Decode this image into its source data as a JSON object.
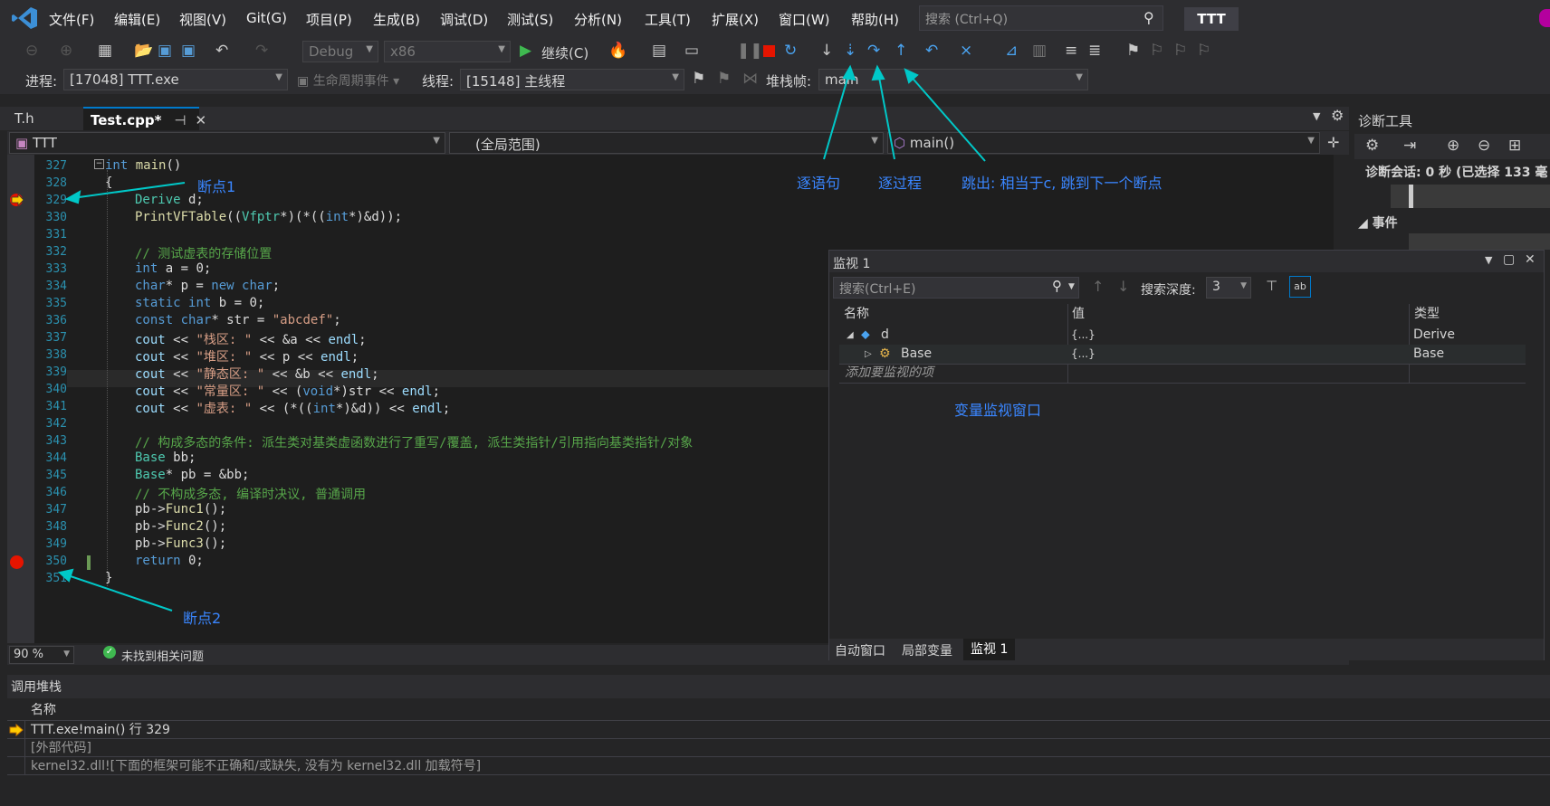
{
  "menubar": {
    "items": [
      "文件(F)",
      "编辑(E)",
      "视图(V)",
      "Git(G)",
      "项目(P)",
      "生成(B)",
      "调试(D)",
      "测试(S)",
      "分析(N)",
      "工具(T)",
      "扩展(X)",
      "窗口(W)",
      "帮助(H)"
    ],
    "search_placeholder": "搜索 (Ctrl+Q)",
    "solution_badge": "TTT"
  },
  "toolbar": {
    "config": "Debug",
    "platform": "x86",
    "continue_label": "继续(C)"
  },
  "debugbar": {
    "process_label": "进程:",
    "process_value": "[17048] TTT.exe",
    "lifecycle_label": "生命周期事件",
    "thread_label": "线程:",
    "thread_value": "[15148] 主线程",
    "stackframe_label": "堆栈帧:",
    "stackframe_value": "main"
  },
  "tabs": [
    {
      "label": "T.h"
    },
    {
      "label": "Test.cpp*"
    }
  ],
  "navbar": {
    "project": "TTT",
    "scope": "(全局范围)",
    "member": "main()"
  },
  "editor": {
    "lines": [
      {
        "n": "327",
        "code": "int main()"
      },
      {
        "n": "328",
        "code": "{"
      },
      {
        "n": "329",
        "code": "Derive d;"
      },
      {
        "n": "330",
        "code": "PrintVFTable((Vfptr*)(*((int*)&d));"
      },
      {
        "n": "331",
        "code": ""
      },
      {
        "n": "332",
        "code": "// 测试虚表的存储位置"
      },
      {
        "n": "333",
        "code": "int a = 0;"
      },
      {
        "n": "334",
        "code": "char* p = new char;"
      },
      {
        "n": "335",
        "code": "static int b = 0;"
      },
      {
        "n": "336",
        "code": "const char* str = \"abcdef\";"
      },
      {
        "n": "337",
        "code": "cout << \"栈区: \" << &a << endl;"
      },
      {
        "n": "338",
        "code": "cout << \"堆区: \" << p << endl;"
      },
      {
        "n": "339",
        "code": "cout << \"静态区: \" << &b << endl;"
      },
      {
        "n": "340",
        "code": "cout << \"常量区: \" << (void*)str << endl;"
      },
      {
        "n": "341",
        "code": "cout << \"虚表: \" << (*((int*)&d)) << endl;"
      },
      {
        "n": "342",
        "code": ""
      },
      {
        "n": "343",
        "code": "// 构成多态的条件: 派生类对基类虚函数进行了重写/覆盖, 派生类指针/引用指向基类指针/对象"
      },
      {
        "n": "344",
        "code": "Base bb;"
      },
      {
        "n": "345",
        "code": "Base* pb = &bb;"
      },
      {
        "n": "346",
        "code": "// 不构成多态, 编译时决议, 普通调用"
      },
      {
        "n": "347",
        "code": "pb->Func1();"
      },
      {
        "n": "348",
        "code": "pb->Func2();"
      },
      {
        "n": "349",
        "code": "pb->Func3();"
      },
      {
        "n": "350",
        "code": "return 0;"
      },
      {
        "n": "351",
        "code": "}"
      }
    ]
  },
  "annotations": {
    "bp1": "断点1",
    "bp2": "断点2",
    "step_into": "逐语句",
    "step_over": "逐过程",
    "step_out": "跳出: 相当于c, 跳到下一个断点",
    "watch_note": "变量监视窗口"
  },
  "status": {
    "zoom": "90 %",
    "issues": "未找到相关问题"
  },
  "diag": {
    "title": "诊断工具",
    "session": "诊断会话: 0 秒 (已选择 133 毫",
    "events": "事件"
  },
  "watch": {
    "title": "监视 1",
    "search_placeholder": "搜索(Ctrl+E)",
    "depth_label": "搜索深度:",
    "depth_value": "3",
    "col_name": "名称",
    "col_value": "值",
    "col_type": "类型",
    "rows": [
      {
        "name": "d",
        "value": "{...}",
        "type": "Derive"
      },
      {
        "name": "Base",
        "value": "{...}",
        "type": "Base"
      }
    ],
    "add_item": "添加要监视的项",
    "tabs": [
      "自动窗口",
      "局部变量",
      "监视 1"
    ]
  },
  "callstack": {
    "title": "调用堆栈",
    "col_name": "名称",
    "rows": [
      "TTT.exe!main() 行 329",
      "[外部代码]",
      "kernel32.dll![下面的框架可能不正确和/或缺失, 没有为 kernel32.dll 加载符号]"
    ]
  },
  "colors": {
    "accent": "#007acc",
    "annotation": "#3a86ff",
    "arrow": "#00c8c8",
    "breakpoint": "#e51400"
  }
}
